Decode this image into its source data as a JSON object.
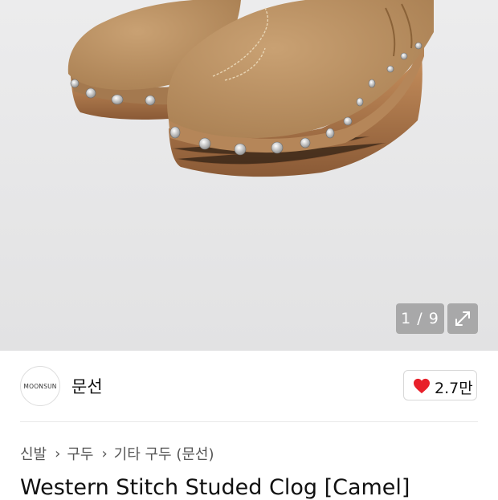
{
  "gallery": {
    "counter": "1 / 9",
    "expand_icon": "expand-icon"
  },
  "brand": {
    "logo_text": "MOONSUN",
    "name": "문선"
  },
  "like": {
    "icon": "heart-icon",
    "count": "2.7만",
    "color": "#e8202a"
  },
  "breadcrumb": {
    "items": [
      "신발",
      "구두",
      "기타 구두 (문선)"
    ]
  },
  "product": {
    "title": "Western Stitch Studed Clog [Camel]"
  }
}
